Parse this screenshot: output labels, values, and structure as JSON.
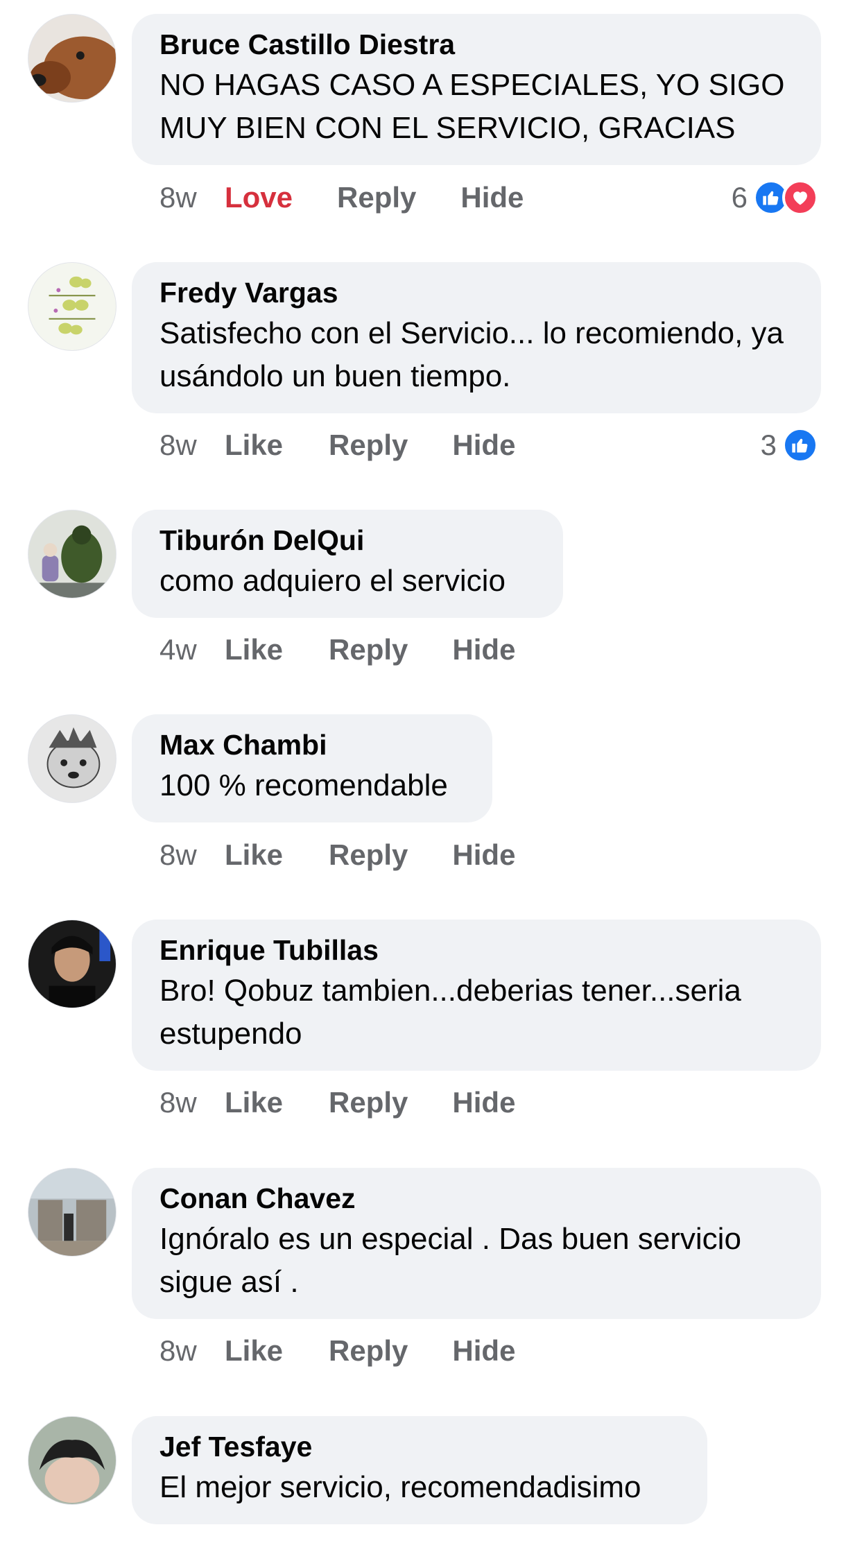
{
  "comments": [
    {
      "author": "Bruce Castillo Diestra",
      "text": "NO HAGAS CASO A ESPECIALES, YO SIGO MUY BIEN CON EL SERVICIO, GRACIAS",
      "time": "8w",
      "like_label": "Love",
      "reply_label": "Reply",
      "hide_label": "Hide",
      "reaction_count": "6",
      "reactions": [
        "like-icon",
        "love-icon"
      ]
    },
    {
      "author": "Fredy Vargas",
      "text": "Satisfecho con el Servicio... lo recomiendo, ya usándolo un buen tiempo.",
      "time": "8w",
      "like_label": "Like",
      "reply_label": "Reply",
      "hide_label": "Hide",
      "reaction_count": "3",
      "reactions": [
        "like-icon"
      ]
    },
    {
      "author": "Tiburón DelQui",
      "text": "como adquiero el servicio",
      "time": "4w",
      "like_label": "Like",
      "reply_label": "Reply",
      "hide_label": "Hide"
    },
    {
      "author": "Max Chambi",
      "text": "100 % recomendable",
      "time": "8w",
      "like_label": "Like",
      "reply_label": "Reply",
      "hide_label": "Hide"
    },
    {
      "author": "Enrique Tubillas",
      "text": "Bro! Qobuz tambien...deberias tener...seria estupendo",
      "time": "8w",
      "like_label": "Like",
      "reply_label": "Reply",
      "hide_label": "Hide"
    },
    {
      "author": "Conan Chavez",
      "text": "Ignóralo es un especial . Das buen servicio sigue así .",
      "time": "8w",
      "like_label": "Like",
      "reply_label": "Reply",
      "hide_label": "Hide"
    },
    {
      "author": "Jef Tesfaye",
      "text": "El mejor servicio, recomendadisimo"
    }
  ],
  "colors": {
    "bubble_bg": "#f0f2f5",
    "secondary_text": "#65676b",
    "love_red": "#d6303d",
    "like_blue": "#1877f2",
    "heart_pink": "#f33e58"
  }
}
